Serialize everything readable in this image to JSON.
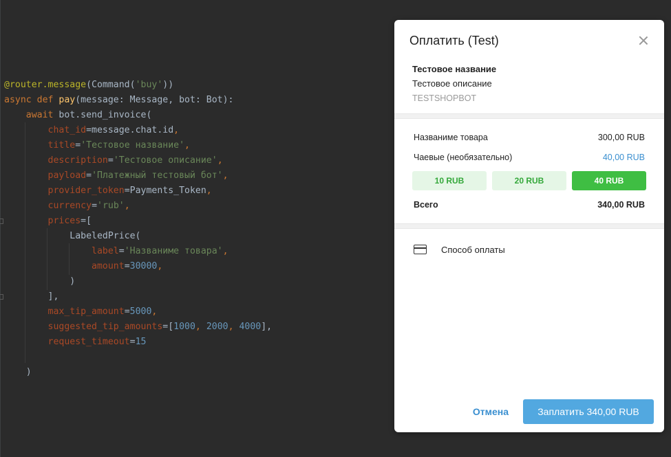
{
  "code": {
    "lines": [
      [
        {
          "t": "@router.message",
          "c": "dec"
        },
        {
          "t": "(Command(",
          "c": "plain"
        },
        {
          "t": "'buy'",
          "c": "str"
        },
        {
          "t": "))",
          "c": "plain"
        }
      ],
      [
        {
          "t": "async def ",
          "c": "kw"
        },
        {
          "t": "pay",
          "c": "fn"
        },
        {
          "t": "(message: Message, bot: Bot):",
          "c": "plain"
        }
      ],
      [
        {
          "t": "    ",
          "c": "plain"
        },
        {
          "t": "await ",
          "c": "kw"
        },
        {
          "t": "bot.send_invoice(",
          "c": "plain"
        }
      ],
      [
        {
          "t": "        ",
          "c": "plain"
        },
        {
          "t": "chat_id",
          "c": "prm"
        },
        {
          "t": "=message.chat.id",
          "c": "plain"
        },
        {
          "t": ",",
          "c": "kw"
        }
      ],
      [
        {
          "t": "        ",
          "c": "plain"
        },
        {
          "t": "title",
          "c": "prm"
        },
        {
          "t": "=",
          "c": "plain"
        },
        {
          "t": "'Тестовое название'",
          "c": "str"
        },
        {
          "t": ",",
          "c": "kw"
        }
      ],
      [
        {
          "t": "        ",
          "c": "plain"
        },
        {
          "t": "description",
          "c": "prm"
        },
        {
          "t": "=",
          "c": "plain"
        },
        {
          "t": "'Тестовое описание'",
          "c": "str"
        },
        {
          "t": ",",
          "c": "kw"
        }
      ],
      [
        {
          "t": "        ",
          "c": "plain"
        },
        {
          "t": "payload",
          "c": "prm"
        },
        {
          "t": "=",
          "c": "plain"
        },
        {
          "t": "'Платежный тестовый бот'",
          "c": "str"
        },
        {
          "t": ",",
          "c": "kw"
        }
      ],
      [
        {
          "t": "        ",
          "c": "plain"
        },
        {
          "t": "provider_token",
          "c": "prm"
        },
        {
          "t": "=Payments_Token",
          "c": "plain"
        },
        {
          "t": ",",
          "c": "kw"
        }
      ],
      [
        {
          "t": "        ",
          "c": "plain"
        },
        {
          "t": "currency",
          "c": "prm"
        },
        {
          "t": "=",
          "c": "plain"
        },
        {
          "t": "'rub'",
          "c": "str"
        },
        {
          "t": ",",
          "c": "kw"
        }
      ],
      [
        {
          "t": "        ",
          "c": "plain"
        },
        {
          "t": "prices",
          "c": "prm"
        },
        {
          "t": "=[",
          "c": "plain"
        }
      ],
      [
        {
          "t": "            LabeledPrice(",
          "c": "plain"
        }
      ],
      [
        {
          "t": "                ",
          "c": "plain"
        },
        {
          "t": "label",
          "c": "prm"
        },
        {
          "t": "=",
          "c": "plain"
        },
        {
          "t": "'Названиме товара'",
          "c": "str"
        },
        {
          "t": ",",
          "c": "kw"
        }
      ],
      [
        {
          "t": "                ",
          "c": "plain"
        },
        {
          "t": "amount",
          "c": "prm"
        },
        {
          "t": "=",
          "c": "plain"
        },
        {
          "t": "30000",
          "c": "num"
        },
        {
          "t": ",",
          "c": "kw"
        }
      ],
      [
        {
          "t": "            )",
          "c": "plain"
        }
      ],
      [
        {
          "t": "        ],",
          "c": "plain"
        }
      ],
      [
        {
          "t": "        ",
          "c": "plain"
        },
        {
          "t": "max_tip_amount",
          "c": "prm"
        },
        {
          "t": "=",
          "c": "plain"
        },
        {
          "t": "5000",
          "c": "num"
        },
        {
          "t": ",",
          "c": "kw"
        }
      ],
      [
        {
          "t": "        ",
          "c": "plain"
        },
        {
          "t": "suggested_tip_amounts",
          "c": "prm"
        },
        {
          "t": "=[",
          "c": "plain"
        },
        {
          "t": "1000",
          "c": "num"
        },
        {
          "t": ", ",
          "c": "kw"
        },
        {
          "t": "2000",
          "c": "num"
        },
        {
          "t": ", ",
          "c": "kw"
        },
        {
          "t": "4000",
          "c": "num"
        },
        {
          "t": "],",
          "c": "plain"
        }
      ],
      [
        {
          "t": "        ",
          "c": "plain"
        },
        {
          "t": "request_timeout",
          "c": "prm"
        },
        {
          "t": "=",
          "c": "plain"
        },
        {
          "t": "15",
          "c": "num"
        }
      ],
      [
        {
          "t": "",
          "c": "plain"
        }
      ],
      [
        {
          "t": "    )",
          "c": "plain"
        }
      ]
    ]
  },
  "dialog": {
    "title": "Оплатить (Test)",
    "product_name": "Тестовое название",
    "product_description": "Тестовое описание",
    "shop_name": "TESTSHOPBOT",
    "item_label": "Названиме товара",
    "item_price": "300,00 RUB",
    "tip_label": "Чаевые (необязательно)",
    "tip_value": "40,00 RUB",
    "tip_options": [
      "10 RUB",
      "20 RUB",
      "40 RUB"
    ],
    "selected_tip": 2,
    "total_label": "Всего",
    "total_value": "340,00 RUB",
    "payment_method_label": "Способ оплаты",
    "cancel_label": "Отмена",
    "pay_label": "Заплатить 340,00 RUB",
    "accent_color": "#3a8fd0",
    "tip_selected_color": "#3fbe43"
  }
}
